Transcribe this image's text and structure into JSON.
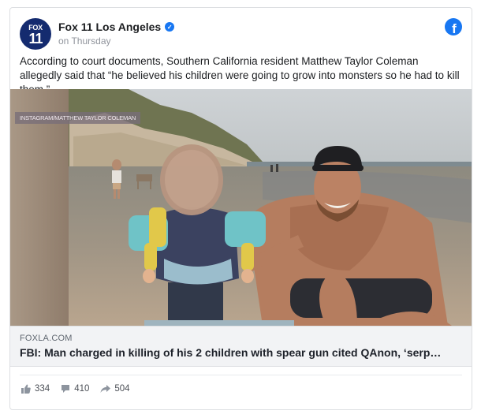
{
  "post": {
    "page_name": "Fox 11 Los Angeles",
    "avatar_top": "FOX",
    "avatar_num": "11",
    "timestamp": "on Thursday",
    "text": "According to court documents, Southern California resident Matthew Taylor Coleman allegedly said that “he believed his children were going to grow into monsters so he had to kill them.”"
  },
  "photo": {
    "caption": "INSTAGRAM/MATTHEW TAYLOR COLEMAN"
  },
  "link": {
    "domain": "FOXLA.COM",
    "title": "FBI: Man charged in killing of his 2 children with spear gun cited QAnon, ‘serp…"
  },
  "engagement": {
    "likes": "334",
    "comments": "410",
    "shares": "504"
  },
  "colors": {
    "brand_blue": "#1877f2",
    "fox_navy": "#142b6f"
  },
  "icons": {
    "platform": "facebook-icon",
    "verified": "verified-badge-icon"
  }
}
